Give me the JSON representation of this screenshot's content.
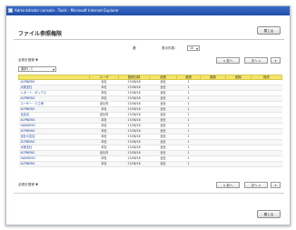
{
  "window": {
    "title": "Administrator console - Tools - Microsoft Internet Explorer"
  },
  "header": {
    "page_title": "ファイル参照権限",
    "close_label": "閉じる"
  },
  "filter": {
    "left_select": "選択して",
    "center_label": "選",
    "right_label": "表示件数：",
    "right_select": "10"
  },
  "toolbar_top": {
    "label": "全員を登録 ▼",
    "page_prev": "< 前へ",
    "page_next": "次へ >"
  },
  "table": {
    "columns": [
      "",
      "ユーザ",
      "登録日時",
      "状態",
      "参照",
      "更新",
      "削除",
      "操作"
    ],
    "rows": [
      [
        "ACPNEWS",
        "全社",
        "17/08/18",
        "全社",
        "1",
        "",
        "",
        ""
      ],
      [
        "大阪支社",
        "本社",
        "17/08/18",
        "全社",
        "1",
        "",
        "",
        ""
      ],
      [
        "レポート・ボックス",
        "本社",
        "17/08/18",
        "全社",
        "1",
        "",
        "",
        ""
      ],
      [
        "ACPNEWS",
        "本社",
        "17/08/18",
        "全社",
        "1",
        "",
        "",
        ""
      ],
      [
        "ユーザー・人工房",
        "全社内",
        "17/08/18",
        "全社",
        "1",
        "",
        "",
        ""
      ],
      [
        "ACPNEWS",
        "本社",
        "17/08/18",
        "全社",
        "1",
        "",
        "",
        ""
      ],
      [
        "全支店",
        "全社内",
        "17/08/18",
        "全社",
        "1",
        "",
        "",
        ""
      ],
      [
        "ACPNEWS",
        "本社",
        "17/08/18",
        "全社",
        "1",
        "",
        "",
        ""
      ],
      [
        "HANSEISO",
        "本社",
        "17/08/18",
        "全社",
        "1",
        "",
        "",
        ""
      ],
      [
        "ACPNEWS",
        "本社",
        "17/08/18",
        "全社",
        "1",
        "",
        "",
        ""
      ],
      [
        "全社の支店",
        "本社",
        "17/08/18",
        "全社",
        "1",
        "",
        "",
        ""
      ],
      [
        "ACPNEWS",
        "本社",
        "17/08/18",
        "全社",
        "1",
        "",
        "",
        ""
      ],
      [
        "大阪支社",
        "本社",
        "17/08/18",
        "全社",
        "1",
        "",
        "",
        ""
      ],
      [
        "ACPNEWS",
        "全社内",
        "17/08/18",
        "全社",
        "1",
        "",
        "",
        ""
      ],
      [
        "HANSEISO",
        "本社",
        "17/08/18",
        "全社",
        "1",
        "",
        "",
        ""
      ],
      [
        "ACPNEWS",
        "本社",
        "17/08/18",
        "全社",
        "1",
        "",
        "",
        ""
      ]
    ]
  },
  "toolbar_bottom": {
    "label": "全員を登録 ▼",
    "page_prev": "< 前へ",
    "page_next": "次へ >"
  },
  "footer": {
    "close_label": "閉じる"
  },
  "colors": {
    "titlebar": "#1f4fa8",
    "table_header": "#f3e46a"
  }
}
